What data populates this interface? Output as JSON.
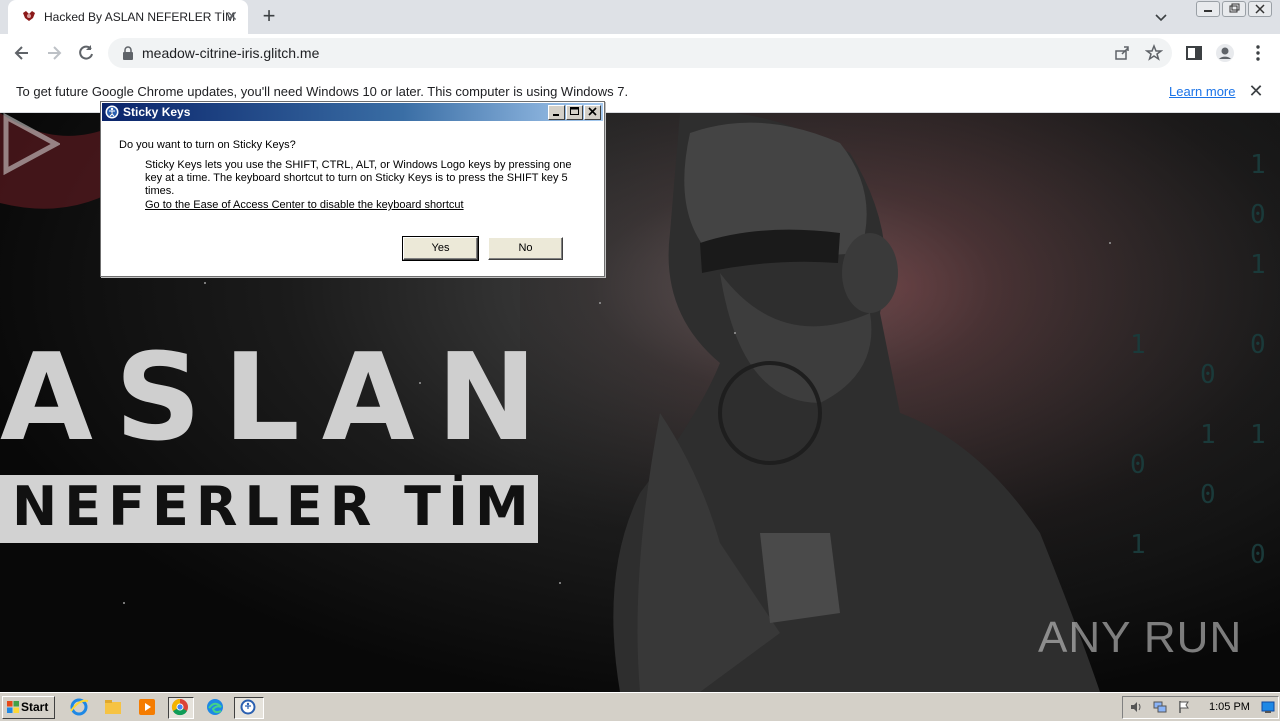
{
  "browser": {
    "tab_title": "Hacked By ASLAN NEFERLER TİM",
    "url": "meadow-citrine-iris.glitch.me",
    "infobar_text": "To get future Google Chrome updates, you'll need Windows 10 or later. This computer is using Windows 7.",
    "infobar_link": "Learn more"
  },
  "page": {
    "brand_line1": "ASLAN",
    "brand_line2": "NEFERLER TİM",
    "watermark": "ANY RUN"
  },
  "dialog": {
    "title": "Sticky Keys",
    "question": "Do you want to turn on Sticky Keys?",
    "description": "Sticky Keys lets you use the SHIFT, CTRL, ALT, or Windows Logo keys by pressing one key at a time. The keyboard shortcut to turn on Sticky Keys is to press the SHIFT key 5 times.",
    "link": "Go to the Ease of Access Center to disable the keyboard shortcut",
    "yes_label": "Yes",
    "no_label": "No"
  },
  "taskbar": {
    "start_label": "Start",
    "clock": "1:05 PM"
  }
}
